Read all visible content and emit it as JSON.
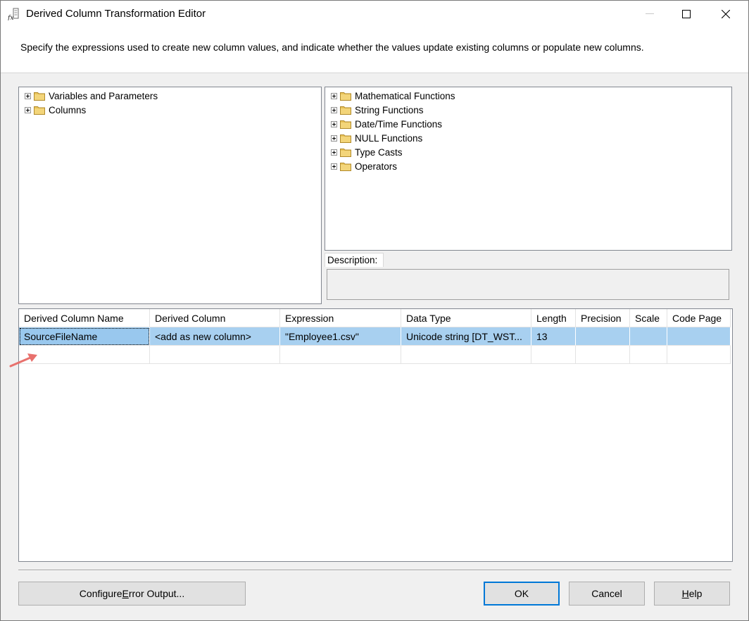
{
  "window": {
    "title": "Derived Column Transformation Editor",
    "icon": "derived-column-fx-icon"
  },
  "instruction": "Specify the expressions used to create new column values, and indicate whether the values update existing columns or populate new columns.",
  "left_tree": {
    "items": [
      {
        "label": "Variables and Parameters",
        "icon": "folder-icon"
      },
      {
        "label": "Columns",
        "icon": "folder-icon"
      }
    ]
  },
  "right_tree": {
    "items": [
      {
        "label": "Mathematical Functions",
        "icon": "folder-icon"
      },
      {
        "label": "String Functions",
        "icon": "folder-icon"
      },
      {
        "label": "Date/Time Functions",
        "icon": "folder-icon"
      },
      {
        "label": "NULL Functions",
        "icon": "folder-icon"
      },
      {
        "label": "Type Casts",
        "icon": "folder-icon"
      },
      {
        "label": "Operators",
        "icon": "folder-icon"
      }
    ]
  },
  "description": {
    "label": "Description:",
    "value": ""
  },
  "grid": {
    "columns": [
      "Derived Column Name",
      "Derived Column",
      "Expression",
      "Data Type",
      "Length",
      "Precision",
      "Scale",
      "Code Page"
    ],
    "rows": [
      [
        "SourceFileName",
        "<add as new column>",
        "\"Employee1.csv\"",
        "Unicode string [DT_WST...",
        "13",
        "",
        "",
        ""
      ]
    ]
  },
  "buttons": {
    "configure_pre": "Configure ",
    "configure_mnemonic": "E",
    "configure_post": "rror Output...",
    "ok": "OK",
    "cancel": "Cancel",
    "help_mnemonic": "H",
    "help_post": "elp"
  },
  "colors": {
    "selection": "#a8d0f0",
    "default_button_border": "#0078d7",
    "folder": "#e8c35a",
    "annotation_arrow": "#e8716d"
  }
}
